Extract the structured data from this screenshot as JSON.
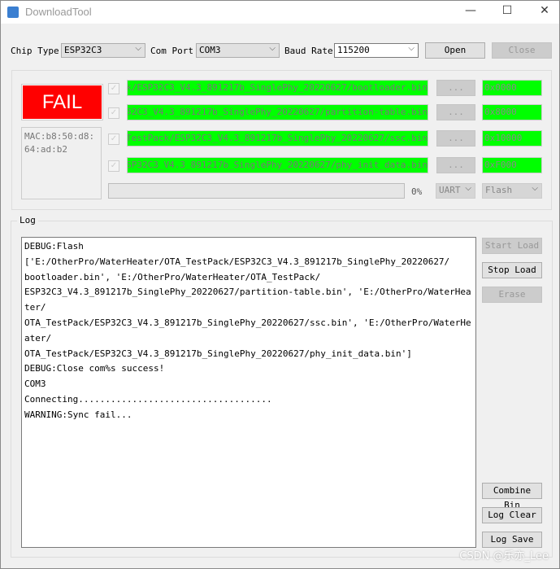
{
  "window": {
    "title": "DownloadTool",
    "minimize": "—",
    "maximize": "☐",
    "close": "✕"
  },
  "toolbar": {
    "chip_type_label": "Chip Type",
    "chip_type_value": "ESP32C3",
    "com_port_label": "Com Port",
    "com_port_value": "COM3",
    "baud_rate_label": "Baud Rate",
    "baud_rate_value": "115200",
    "open_label": "Open",
    "close_label": "Close"
  },
  "status": {
    "result": "FAIL",
    "result_color": "#ff0000",
    "mac": "MAC:b8:50:d8:64:ad:b2"
  },
  "files": [
    {
      "checked": true,
      "path": "E:/OtherPro/WaterHeater/OTA_TestPack/ESP32C3_V4.3_891217b_SinglePhy_20220627/bootloader.bin",
      "browse": "...",
      "address": "0x0000"
    },
    {
      "checked": true,
      "path": "E:/OtherPro/WaterHeater/OTA_TestPack/ESP32C3_V4.3_891217b_SinglePhy_20220627/partition-table.bin",
      "browse": "...",
      "address": "0x8000"
    },
    {
      "checked": true,
      "path": "E:/OtherPro/WaterHeater/OTA_TestPack/ESP32C3_V4.3_891217b_SinglePhy_20220627/ssc.bin",
      "browse": "...",
      "address": "0x10000"
    },
    {
      "checked": true,
      "path": "E:/OtherPro/WaterHeater/OTA_TestPack/ESP32C3_V4.3_891217b_SinglePhy_20220627/phy_init_data.bin",
      "browse": "...",
      "address": "0xF000"
    }
  ],
  "progress": {
    "percent_label": "0%",
    "value": 0,
    "mode": "UART",
    "target": "Flash"
  },
  "log": {
    "title": "Log",
    "lines": [
      "DEBUG:Flash",
      "['E:/OtherPro/WaterHeater/OTA_TestPack/ESP32C3_V4.3_891217b_SinglePhy_20220627/",
      "bootloader.bin', 'E:/OtherPro/WaterHeater/OTA_TestPack/",
      "ESP32C3_V4.3_891217b_SinglePhy_20220627/partition-table.bin', 'E:/OtherPro/WaterHeater/",
      "OTA_TestPack/ESP32C3_V4.3_891217b_SinglePhy_20220627/ssc.bin', 'E:/OtherPro/WaterHeater/",
      "OTA_TestPack/ESP32C3_V4.3_891217b_SinglePhy_20220627/phy_init_data.bin']",
      "DEBUG:Close com%s success!",
      "COM3",
      "Connecting....................................",
      "WARNING:Sync fail..."
    ],
    "start_load": "Start Load",
    "stop_load": "Stop Load",
    "erase": "Erase",
    "combine_bin": "Combine Bin",
    "log_clear": "Log Clear",
    "log_save": "Log Save"
  },
  "watermark": "CSDN @乐亦_Lee"
}
